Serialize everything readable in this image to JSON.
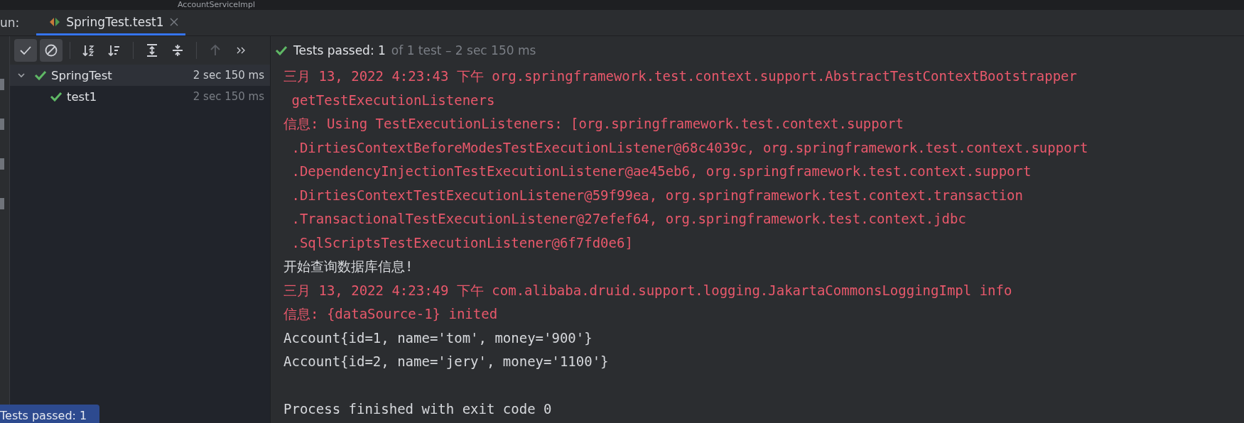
{
  "editor_tab": {
    "label": "AccountServiceImpl"
  },
  "run_bar": {
    "label": "un:",
    "tabs": [
      {
        "label": "SpringTest.test1",
        "selected": true
      }
    ]
  },
  "toolbar": [
    {
      "kind": "check",
      "selected": true,
      "disabled": false
    },
    {
      "kind": "stop",
      "selected": true,
      "disabled": false
    },
    {
      "kind": "sort-alpha",
      "selected": false,
      "disabled": false
    },
    {
      "kind": "sort-duration",
      "selected": false,
      "disabled": false
    },
    {
      "kind": "expand",
      "selected": false,
      "disabled": false
    },
    {
      "kind": "collapse",
      "selected": false,
      "disabled": false
    },
    {
      "kind": "up",
      "selected": false,
      "disabled": true
    },
    {
      "kind": "more",
      "selected": false,
      "disabled": false
    }
  ],
  "status": {
    "passed": "Tests passed: 1",
    "detail": "of 1 test – 2 sec 150 ms"
  },
  "tree": [
    {
      "name": "SpringTest",
      "time": "2 sec 150 ms",
      "selected": true,
      "expanded": true,
      "children": [
        {
          "name": "test1",
          "time": "2 sec 150 ms",
          "selected": false
        }
      ]
    }
  ],
  "console": [
    {
      "kind": "stderr",
      "text": "三月 13, 2022 4:23:43 下午 org.springframework.test.context.support.AbstractTestContextBootstrapper"
    },
    {
      "kind": "stderr",
      "text": " getTestExecutionListeners"
    },
    {
      "kind": "stderr",
      "text": "信息: Using TestExecutionListeners: [org.springframework.test.context.support"
    },
    {
      "kind": "stderr",
      "text": " .DirtiesContextBeforeModesTestExecutionListener@68c4039c, org.springframework.test.context.support"
    },
    {
      "kind": "stderr",
      "text": " .DependencyInjectionTestExecutionListener@ae45eb6, org.springframework.test.context.support"
    },
    {
      "kind": "stderr",
      "text": " .DirtiesContextTestExecutionListener@59f99ea, org.springframework.test.context.transaction"
    },
    {
      "kind": "stderr",
      "text": " .TransactionalTestExecutionListener@27efef64, org.springframework.test.context.jdbc"
    },
    {
      "kind": "stderr",
      "text": " .SqlScriptsTestExecutionListener@6f7fd0e6]"
    },
    {
      "kind": "stdout",
      "text": "开始查询数据库信息!"
    },
    {
      "kind": "stderr",
      "text": "三月 13, 2022 4:23:49 下午 com.alibaba.druid.support.logging.JakartaCommonsLoggingImpl info"
    },
    {
      "kind": "stderr",
      "text": "信息: {dataSource-1} inited"
    },
    {
      "kind": "stdout",
      "text": "Account{id=1, name='tom', money='900'}"
    },
    {
      "kind": "stdout",
      "text": "Account{id=2, name='jery', money='1100'}"
    },
    {
      "kind": "blank"
    },
    {
      "kind": "stdout",
      "text": "Process finished with exit code 0"
    }
  ],
  "notification": {
    "text": "Tests passed: 1"
  }
}
